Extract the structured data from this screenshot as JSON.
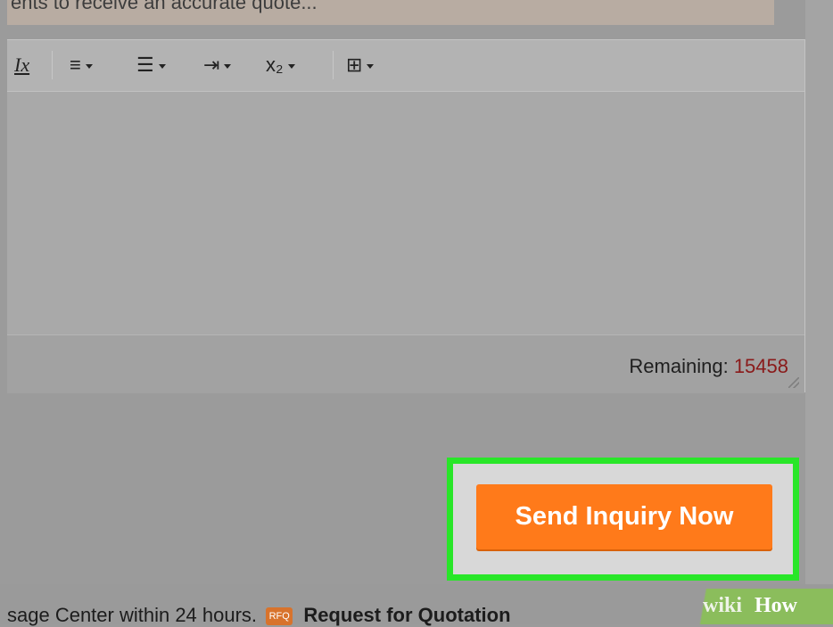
{
  "hint": {
    "text": "ents to receive an accurate quote..."
  },
  "toolbar": {
    "clear_format_icon": "Ix",
    "align_icon": "≡",
    "list_icon": "☰",
    "indent_icon": "⇥",
    "subscript_icon": "x₂",
    "table_icon": "⊞"
  },
  "editor": {
    "remaining_label": "Remaining:",
    "remaining_count": "15458"
  },
  "actions": {
    "send_label": "Send Inquiry Now"
  },
  "footer": {
    "text": "sage Center within 24 hours.",
    "badge": "RFQ",
    "rfq_link": "Request for Quotation"
  },
  "watermark": {
    "wiki": "wiki",
    "how": "How"
  },
  "colors": {
    "button": "#ff7a1a",
    "highlight": "#28e628",
    "remaining_count": "#8a1a1a"
  }
}
